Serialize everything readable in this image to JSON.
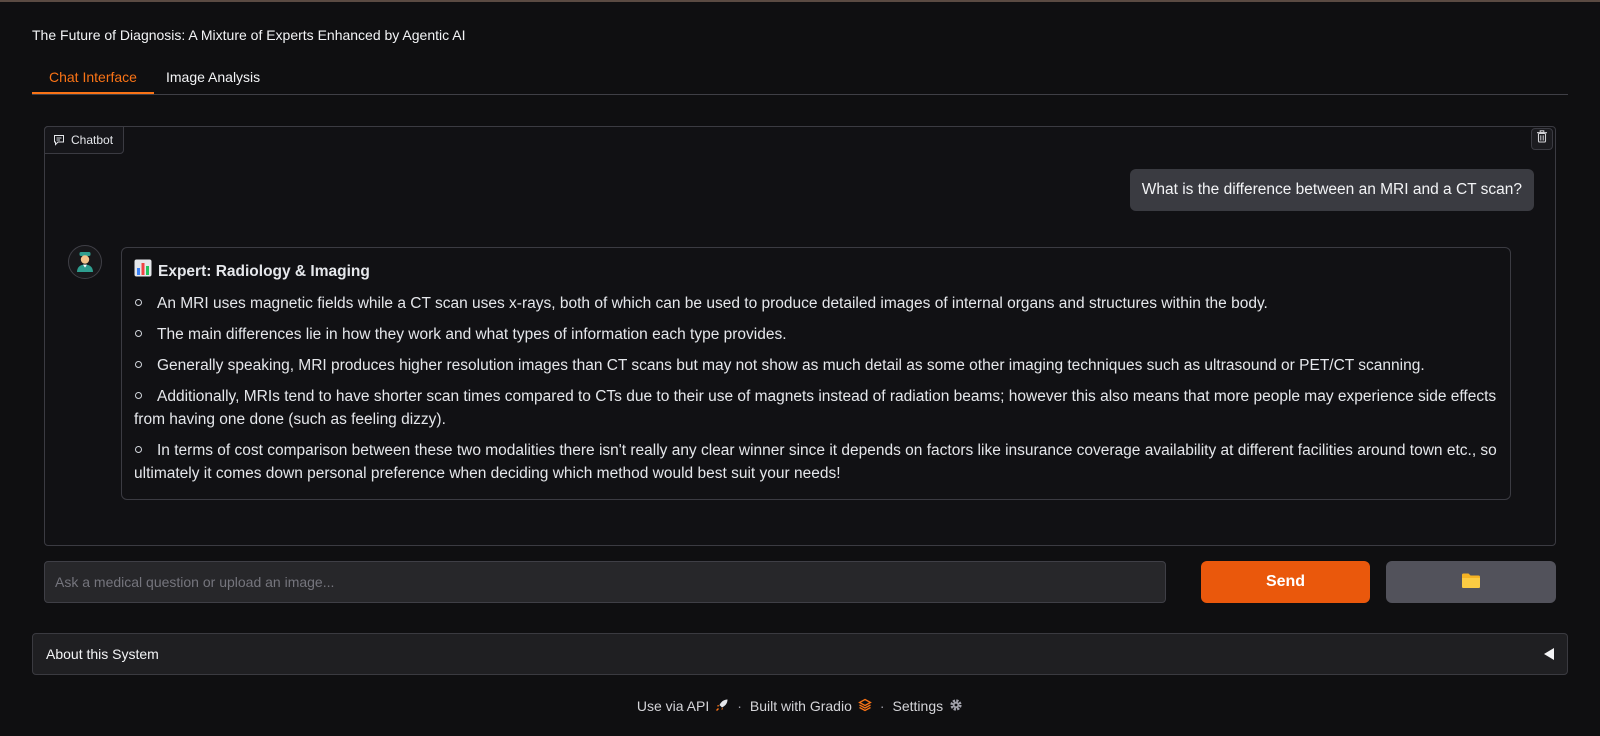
{
  "app": {
    "title": "The Future of Diagnosis: A Mixture of Experts Enhanced by Agentic AI"
  },
  "tabs": [
    {
      "label": "Chat Interface",
      "active": true
    },
    {
      "label": "Image Analysis",
      "active": false
    }
  ],
  "chatbot": {
    "label": "Chatbot",
    "user_message": "What is the difference between an MRI and a CT scan?",
    "bot_message": {
      "expert_title": "Expert: Radiology & Imaging",
      "bullets": [
        "An MRI uses magnetic fields while a CT scan uses x-rays, both of which can be used to produce detailed images of internal organs and structures within the body.",
        "The main differences lie in how they work and what types of information each type provides.",
        "Generally speaking, MRI produces higher resolution images than CT scans but may not show as much detail as some other imaging techniques such as ultrasound or PET/CT scanning.",
        "Additionally, MRIs tend to have shorter scan times compared to CTs due to their use of magnets instead of radiation beams; however this also means that more people may experience side effects from having one done (such as feeling dizzy).",
        "In terms of cost comparison between these two modalities there isn't really any clear winner since it depends on factors like insurance coverage availability at different facilities around town etc., so ultimately it comes down personal preference when deciding which method would best suit your needs!"
      ]
    }
  },
  "input": {
    "placeholder": "Ask a medical question or upload an image...",
    "value": ""
  },
  "buttons": {
    "send": "Send"
  },
  "about": {
    "label": "About this System"
  },
  "footer": {
    "api": "Use via API",
    "built": "Built with Gradio",
    "settings": "Settings",
    "separator": "·"
  },
  "colors": {
    "accent": "#ea580c",
    "tab_active": "#f97316",
    "background": "#0f0f11"
  },
  "icons": {
    "chatbot": "chat-bubble-icon",
    "trash": "trash-icon",
    "avatar": "doctor-avatar-icon",
    "expert": "chart-icon",
    "upload": "folder-icon",
    "about_toggle": "triangle-left-icon",
    "api": "rocket-icon",
    "gradio": "gradio-logo-icon",
    "settings": "gear-icon"
  }
}
